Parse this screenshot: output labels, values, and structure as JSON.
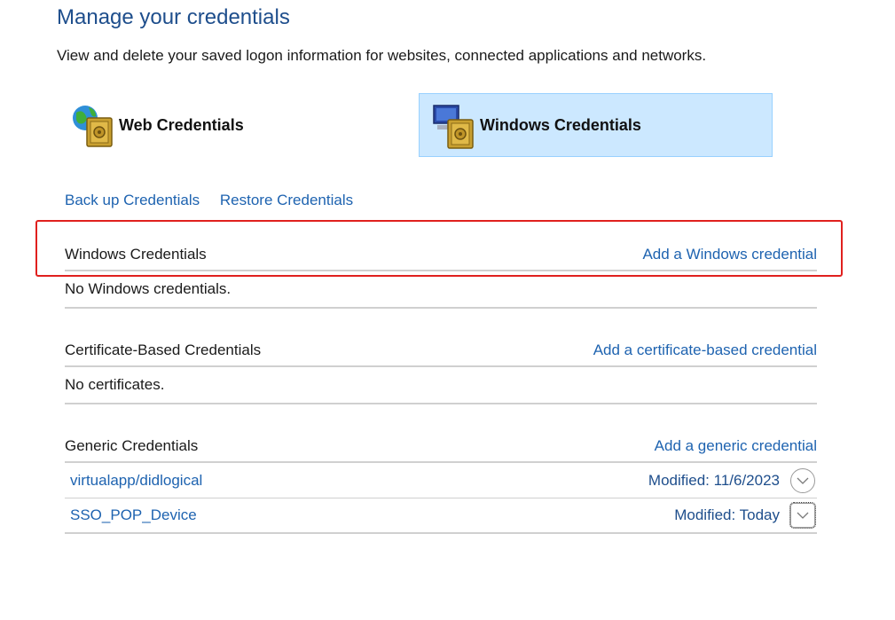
{
  "header": {
    "title": "Manage your credentials",
    "subtitle": "View and delete your saved logon information for websites, connected applications and networks."
  },
  "tabs": [
    {
      "label": "Web Credentials",
      "icon": "globe-vault-icon",
      "selected": false
    },
    {
      "label": "Windows Credentials",
      "icon": "computer-vault-icon",
      "selected": true
    }
  ],
  "actions": {
    "backup": "Back up Credentials",
    "restore": "Restore Credentials"
  },
  "sections": {
    "windows": {
      "title": "Windows Credentials",
      "add_link": "Add a Windows credential",
      "empty_text": "No Windows credentials."
    },
    "certificate": {
      "title": "Certificate-Based Credentials",
      "add_link": "Add a certificate-based credential",
      "empty_text": "No certificates."
    },
    "generic": {
      "title": "Generic Credentials",
      "add_link": "Add a generic credential",
      "items": [
        {
          "name": "virtualapp/didlogical",
          "modified": "Modified:  11/6/2023"
        },
        {
          "name": "SSO_POP_Device",
          "modified": "Modified:  Today"
        }
      ]
    }
  },
  "colors": {
    "accent": "#1e63b0",
    "title": "#1e4e8c",
    "selected_bg": "#cce8ff",
    "highlight": "#e0201e"
  }
}
